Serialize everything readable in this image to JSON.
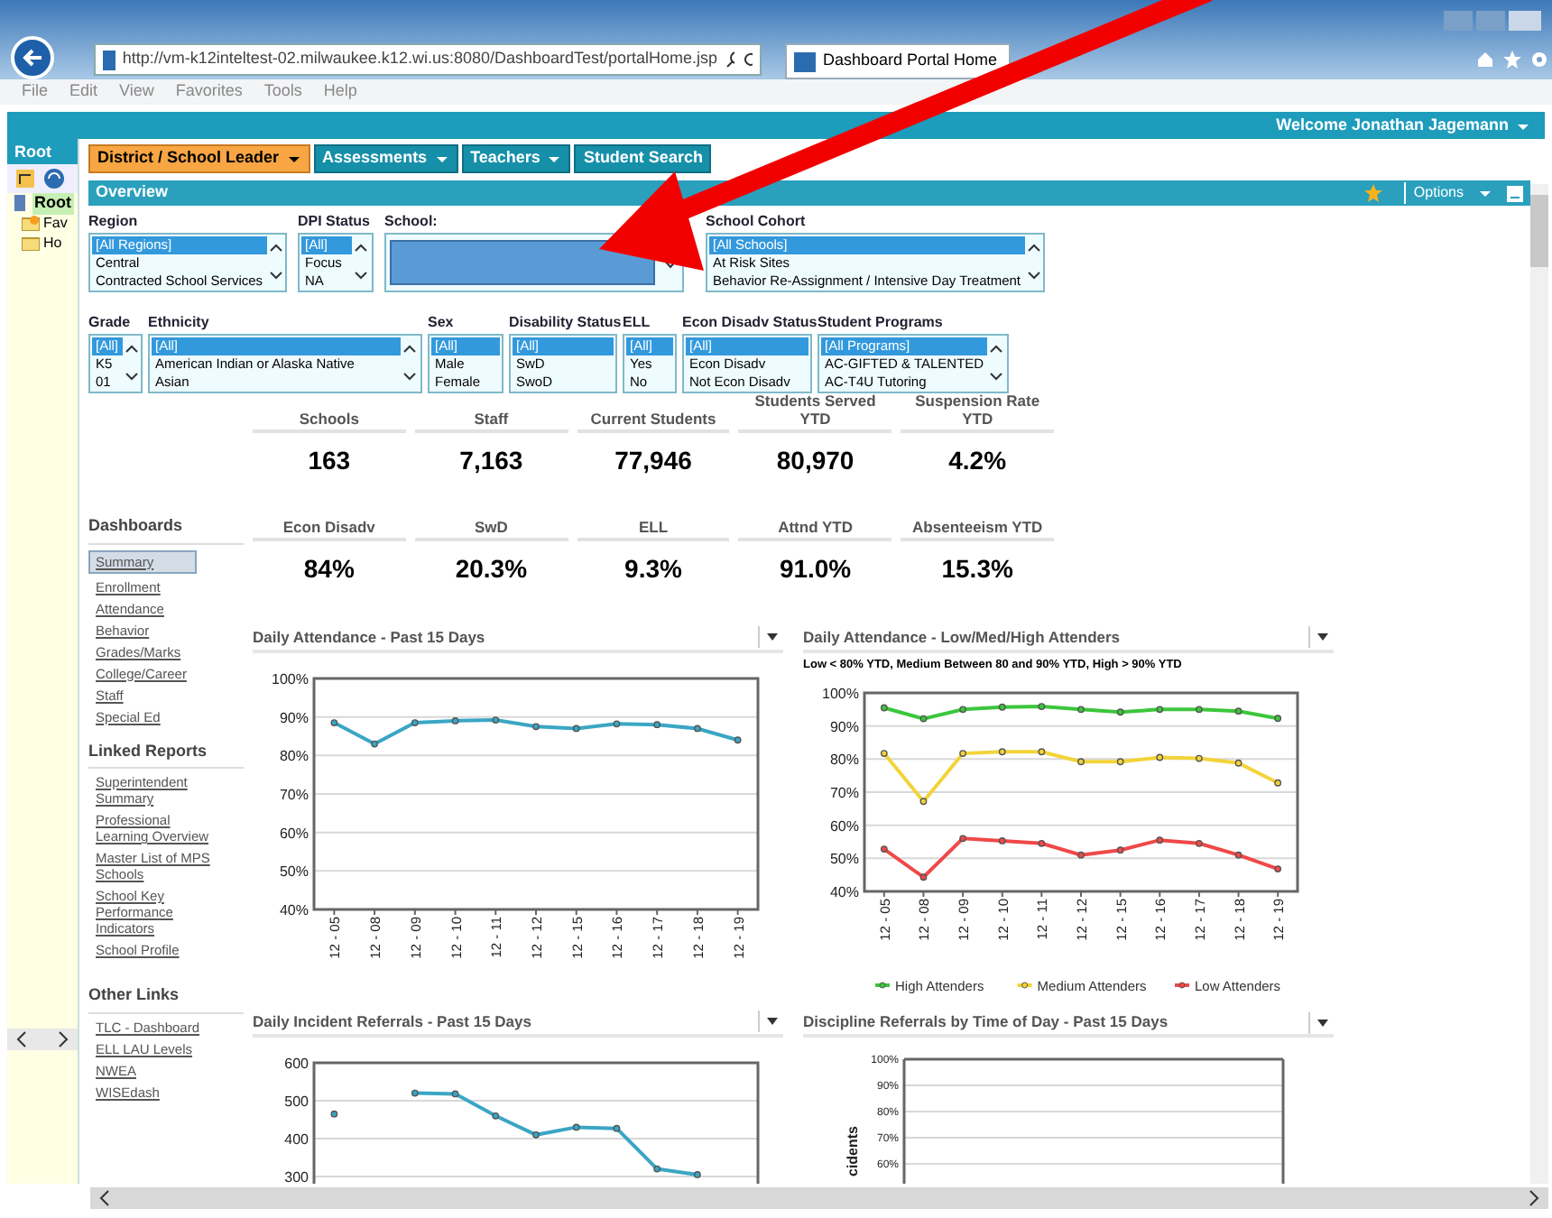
{
  "browser": {
    "url": "http://vm-k12inteltest-02.milwaukee.k12.wi.us:8080/DashboardTest/portalHome.jsp",
    "tab_title": "Dashboard Portal Home",
    "menu": [
      "File",
      "Edit",
      "View",
      "Favorites",
      "Tools",
      "Help"
    ]
  },
  "header": {
    "welcome": "Welcome Jonathan Jagemann"
  },
  "left_pane": {
    "title": "Root",
    "tree": [
      {
        "label": "Root",
        "selected": true,
        "children": [
          {
            "label": "Fav",
            "kind": "favorites"
          },
          {
            "label": "Ho",
            "kind": "folder"
          }
        ]
      }
    ]
  },
  "nav_tabs": [
    {
      "label": "District / School Leader",
      "selected": true,
      "menu": true
    },
    {
      "label": "Assessments",
      "selected": false,
      "menu": true
    },
    {
      "label": "Teachers",
      "selected": false,
      "menu": true
    },
    {
      "label": "Student Search",
      "selected": false,
      "menu": false
    }
  ],
  "overview": {
    "title": "Overview",
    "options": "Options"
  },
  "filters": [
    {
      "label": "Region",
      "kind": "list",
      "options": [
        {
          "label": "[All Regions]",
          "selected": true
        },
        {
          "label": "Central",
          "selected": false
        },
        {
          "label": "Contracted School Services",
          "selected": false
        }
      ]
    },
    {
      "label": "DPI Status",
      "kind": "list",
      "options": [
        {
          "label": "[All]",
          "selected": true
        },
        {
          "label": "Focus",
          "selected": false
        },
        {
          "label": "NA",
          "selected": false
        }
      ]
    },
    {
      "label": "School:",
      "kind": "redacted"
    },
    {
      "label": "School Cohort",
      "kind": "list",
      "options": [
        {
          "label": "[All Schools]",
          "selected": true
        },
        {
          "label": "At Risk Sites",
          "selected": false
        },
        {
          "label": "Behavior Re-Assignment / Intensive Day Treatment",
          "selected": false
        }
      ]
    },
    {
      "label": "Grade",
      "kind": "list",
      "options": [
        {
          "label": "[All]",
          "selected": true
        },
        {
          "label": "K5",
          "selected": false
        },
        {
          "label": "01",
          "selected": false
        }
      ]
    },
    {
      "label": "Ethnicity",
      "kind": "list",
      "options": [
        {
          "label": "[All]",
          "selected": true
        },
        {
          "label": "American Indian or Alaska Native",
          "selected": false
        },
        {
          "label": "Asian",
          "selected": false
        }
      ]
    },
    {
      "label": "Sex",
      "kind": "plain",
      "options": [
        {
          "label": "[All]",
          "selected": true
        },
        {
          "label": "Male",
          "selected": false
        },
        {
          "label": "Female",
          "selected": false
        }
      ]
    },
    {
      "label": "Disability Status",
      "kind": "plain",
      "options": [
        {
          "label": "[All]",
          "selected": true
        },
        {
          "label": "SwD",
          "selected": false
        },
        {
          "label": "SwoD",
          "selected": false
        }
      ]
    },
    {
      "label": "ELL",
      "kind": "plain",
      "options": [
        {
          "label": "[All]",
          "selected": true
        },
        {
          "label": "Yes",
          "selected": false
        },
        {
          "label": "No",
          "selected": false
        }
      ]
    },
    {
      "label": "Econ Disadv Status",
      "kind": "plain",
      "options": [
        {
          "label": "[All]",
          "selected": true
        },
        {
          "label": "Econ Disadv",
          "selected": false
        },
        {
          "label": "Not Econ Disadv",
          "selected": false
        }
      ]
    },
    {
      "label": "Student Programs",
      "kind": "list",
      "options": [
        {
          "label": "[All Programs]",
          "selected": true
        },
        {
          "label": "AC-GIFTED & TALENTED",
          "selected": false
        },
        {
          "label": "AC-T4U Tutoring",
          "selected": false
        }
      ]
    }
  ],
  "stats": [
    {
      "label": "Schools",
      "value": "163"
    },
    {
      "label": "Staff",
      "value": "7,163"
    },
    {
      "label": "Current Students",
      "value": "77,946"
    },
    {
      "label": "Students Served YTD",
      "value": "80,970"
    },
    {
      "label": "Suspension Rate YTD",
      "value": "4.2%"
    },
    {
      "label": "Econ Disadv",
      "value": "84%"
    },
    {
      "label": "SwD",
      "value": "20.3%"
    },
    {
      "label": "ELL",
      "value": "9.3%"
    },
    {
      "label": "Attnd YTD",
      "value": "91.0%"
    },
    {
      "label": "Absenteeism YTD",
      "value": "15.3%"
    }
  ],
  "link_groups": [
    {
      "title": "Dashboards",
      "links": [
        {
          "label": "Summary",
          "selected": true
        },
        {
          "label": "Enrollment",
          "selected": false
        },
        {
          "label": "Attendance",
          "selected": false
        },
        {
          "label": "Behavior",
          "selected": false
        },
        {
          "label": "Grades/Marks",
          "selected": false
        },
        {
          "label": "College/Career",
          "selected": false
        },
        {
          "label": "Staff",
          "selected": false
        },
        {
          "label": "Special Ed",
          "selected": false
        }
      ]
    },
    {
      "title": "Linked Reports",
      "links": [
        {
          "label": "Superintendent Summary",
          "selected": false
        },
        {
          "label": "Professional Learning Overview",
          "selected": false
        },
        {
          "label": "Master List of MPS Schools",
          "selected": false
        },
        {
          "label": "School Key Performance Indicators",
          "selected": false
        },
        {
          "label": "School Profile",
          "selected": false
        }
      ]
    },
    {
      "title": "Other Links",
      "links": [
        {
          "label": "TLC - Dashboard",
          "selected": false
        },
        {
          "label": "ELL LAU Levels",
          "selected": false
        },
        {
          "label": "NWEA",
          "selected": false
        },
        {
          "label": "WISEdash",
          "selected": false
        }
      ]
    }
  ],
  "charts": [
    {
      "title": "Daily Attendance - Past 15 Days",
      "chart_data": {
        "type": "line",
        "grid": true,
        "categories": [
          "12 - 05",
          "12 - 08",
          "12 - 09",
          "12 - 10",
          "12 - 11",
          "12 - 12",
          "12 - 15",
          "12 - 16",
          "12 - 17",
          "12 - 18",
          "12 - 19"
        ],
        "ylim": [
          40,
          100
        ],
        "yticks": [
          {
            "value": 40,
            "label": "40%"
          },
          {
            "value": 50,
            "label": "50%"
          },
          {
            "value": 60,
            "label": "60%"
          },
          {
            "value": 70,
            "label": "70%"
          },
          {
            "value": 80,
            "label": "80%"
          },
          {
            "value": 90,
            "label": "90%"
          },
          {
            "value": 100,
            "label": "100%"
          }
        ],
        "series": [
          {
            "color": "#3aa6c4",
            "marker": "circle",
            "values": [
              88.5,
              83,
              88.5,
              89,
              89.2,
              87.5,
              87,
              88.2,
              88,
              87,
              84
            ]
          }
        ]
      }
    },
    {
      "title": "Daily Attendance - Low/Med/High Attenders",
      "subtitle": "Low < 80% YTD, Medium Between 80 and 90% YTD, High > 90% YTD",
      "chart_data": {
        "type": "line",
        "grid": true,
        "legend": "bottom",
        "categories": [
          "12 - 05",
          "12 - 08",
          "12 - 09",
          "12 - 10",
          "12 - 11",
          "12 - 12",
          "12 - 15",
          "12 - 16",
          "12 - 17",
          "12 - 18",
          "12 - 19"
        ],
        "ylim": [
          40,
          100
        ],
        "yticks": [
          {
            "value": 40,
            "label": "40%"
          },
          {
            "value": 50,
            "label": "50%"
          },
          {
            "value": 60,
            "label": "60%"
          },
          {
            "value": 70,
            "label": "70%"
          },
          {
            "value": 80,
            "label": "80%"
          },
          {
            "value": 90,
            "label": "90%"
          },
          {
            "value": 100,
            "label": "100%"
          }
        ],
        "series": [
          {
            "name": "High Attenders",
            "color": "#3cc63c",
            "marker": "circle",
            "values": [
              95.5,
              92.2,
              95,
              95.7,
              95.9,
              95,
              94.2,
              95,
              95,
              94.5,
              92.3
            ]
          },
          {
            "name": "Medium Attenders",
            "color": "#f2d43a",
            "marker": "circle",
            "values": [
              81.7,
              67.2,
              81.7,
              82.2,
              82.2,
              79.2,
              79.2,
              80.5,
              80.2,
              78.8,
              72.8
            ]
          },
          {
            "name": "Low Attenders",
            "color": "#f04848",
            "marker": "circle",
            "values": [
              52.8,
              44.3,
              56,
              55.3,
              54.5,
              51,
              52.5,
              55.5,
              54.5,
              51,
              46.8
            ]
          }
        ]
      }
    },
    {
      "title": "Daily Incident Referrals - Past 15 Days",
      "chart_data": {
        "type": "line",
        "grid": true,
        "ylim": [
          0,
          600
        ],
        "yticks": [
          300,
          400,
          500,
          600
        ],
        "series": [
          {
            "color": "#3aa6c4",
            "marker": "circle",
            "values": [
              465,
              null,
              520,
              518,
              460,
              410,
              430,
              427,
              320,
              305,
              null
            ]
          }
        ]
      }
    },
    {
      "title": "Discipline Referrals by Time of Day - Past 15 Days",
      "axis_title": "cidents",
      "axis_labels": [
        "100%",
        "90%",
        "80%",
        "70%",
        "60%"
      ]
    }
  ]
}
